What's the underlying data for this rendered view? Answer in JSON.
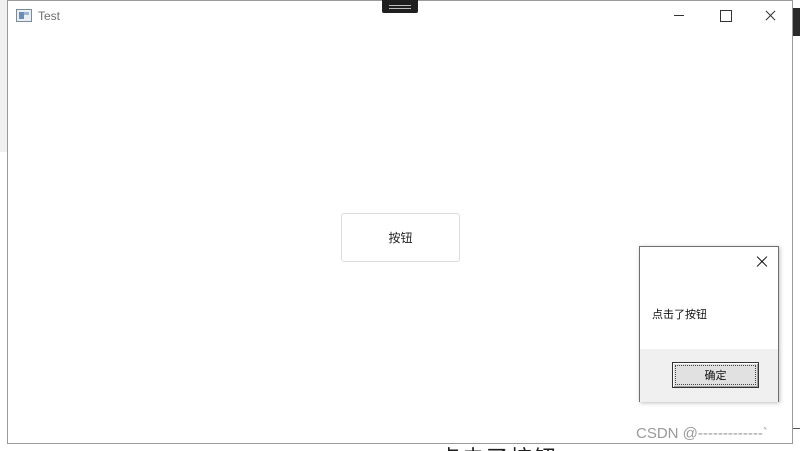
{
  "window": {
    "title": "Test",
    "controls": {
      "minimize_icon": "minimize-icon",
      "maximize_icon": "maximize-icon",
      "close_icon": "close-icon"
    }
  },
  "main": {
    "button_label": "按钮"
  },
  "dialog": {
    "message": "点击了按钮",
    "ok_label": "确定",
    "close_icon": "close-icon"
  },
  "watermark": "CSDN @-------------`",
  "background": {
    "partial_text": "点击了按钮"
  },
  "colors": {
    "window_border": "#9a9a9a",
    "dialog_footer": "#f0f0f0",
    "button_face": "#e1e1e1"
  }
}
